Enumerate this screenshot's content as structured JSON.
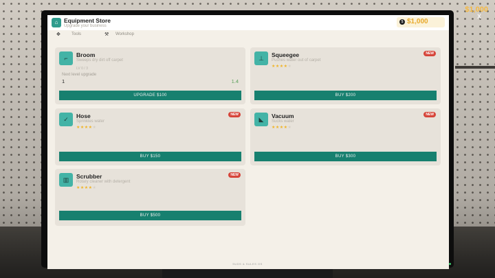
{
  "hud": {
    "money": "$1,000",
    "close": "X"
  },
  "header": {
    "title": "Equipment Store",
    "subtitle": "Upgrade your business"
  },
  "balance": {
    "coin": "$",
    "amount": "$1,000"
  },
  "tabs": [
    {
      "label": "Tools",
      "icon": "wrench-icon"
    },
    {
      "label": "Workshop",
      "icon": "hammer-icon"
    }
  ],
  "items": [
    {
      "name": "Broom",
      "desc": "Sweeps dry dirt off carpet",
      "level": "LV 0 / 3",
      "upgrade_label": "Next level upgrade",
      "current": "1",
      "next": "1.4",
      "button": "UPGRADE $100"
    },
    {
      "name": "Squeegee",
      "desc": "Pushes water out of carpet",
      "rating": 4,
      "badge": "NEW",
      "button": "BUY $200"
    },
    {
      "name": "Hose",
      "desc": "Sprinkles water",
      "rating": 4,
      "badge": "NEW",
      "button": "BUY $150"
    },
    {
      "name": "Vacuum",
      "desc": "Sucks water",
      "rating": 4,
      "badge": "NEW",
      "button": "BUY $300"
    },
    {
      "name": "Scrubber",
      "desc": "Rotary cleaner with detergent",
      "rating": 4,
      "badge": "NEW",
      "button": "BUY $500"
    }
  ],
  "monitor": {
    "label": "SUDS & SULES OS"
  }
}
